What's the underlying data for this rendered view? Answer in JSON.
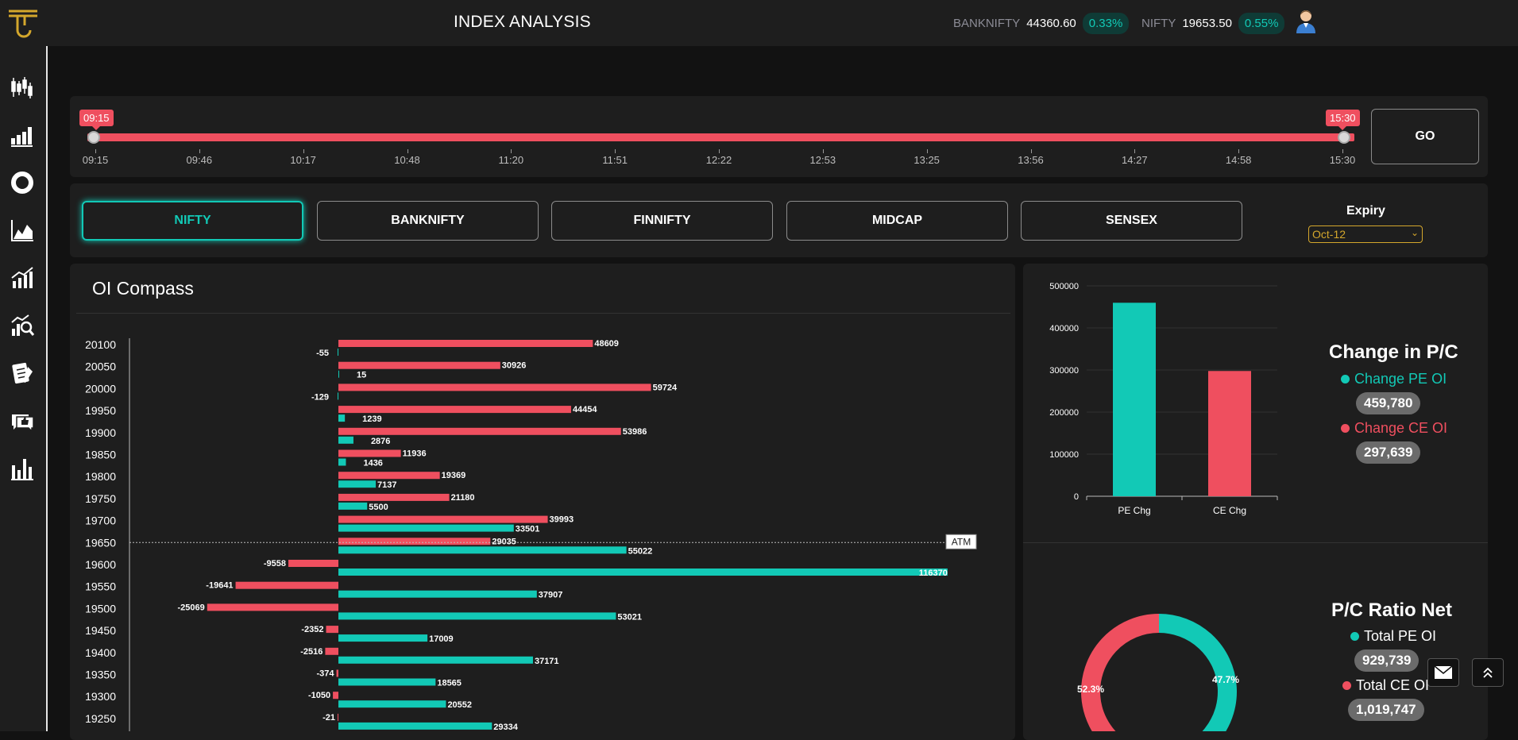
{
  "header": {
    "title": "INDEX ANALYSIS",
    "tickers": [
      {
        "name": "BANKNIFTY",
        "value": "44360.60",
        "change": "0.33%"
      },
      {
        "name": "NIFTY",
        "value": "19653.50",
        "change": "0.55%"
      }
    ]
  },
  "sidebar": {
    "icons": [
      "candlestick-icon",
      "volume-bars-icon",
      "donut-icon",
      "area-chart-icon",
      "growth-chart-icon",
      "analysis-search-icon",
      "notes-icon",
      "chat-like-icon",
      "bar-chart-icon"
    ]
  },
  "time_slider": {
    "start": "09:15",
    "end": "15:30",
    "ticks": [
      "09:15",
      "09:46",
      "10:17",
      "10:48",
      "11:20",
      "11:51",
      "12:22",
      "12:53",
      "13:25",
      "13:56",
      "14:27",
      "14:58",
      "15:30"
    ],
    "range_fraction": [
      0,
      1
    ],
    "go_label": "GO"
  },
  "index_tabs": {
    "items": [
      "NIFTY",
      "BANKNIFTY",
      "FINNIFTY",
      "MIDCAP",
      "SENSEX"
    ],
    "active": "NIFTY"
  },
  "expiry": {
    "label": "Expiry",
    "selected": "Oct-12"
  },
  "oi_compass": {
    "title": "OI Compass",
    "atm_label": "ATM",
    "atm_strike": "19650"
  },
  "change_pc": {
    "title": "Change in P/C",
    "pe_label": "Change PE OI",
    "pe_value": "459,780",
    "ce_label": "Change CE OI",
    "ce_value": "297,639"
  },
  "pc_ratio": {
    "title": "P/C Ratio Net",
    "pe_label": "Total PE OI",
    "pe_value": "929,739",
    "ce_label": "Total CE OI",
    "ce_value": "1,019,747",
    "pe_pct_label": "47.7%",
    "ce_pct_label": "52.3%"
  },
  "colors": {
    "accent": "#12c9b6",
    "call": "#ef4f5f",
    "brand": "#d4a72c",
    "panel": "#1e1e1e",
    "background": "#121212"
  },
  "chart_data": [
    {
      "type": "bar",
      "title": "OI Compass",
      "orientation": "horizontal",
      "categories": [
        "20100",
        "20050",
        "20000",
        "19950",
        "19900",
        "19850",
        "19800",
        "19750",
        "19700",
        "19650",
        "19600",
        "19550",
        "19500",
        "19450",
        "19400",
        "19350",
        "19300",
        "19250"
      ],
      "series": [
        {
          "values": [
            48609,
            30926,
            59724,
            44454,
            53986,
            11936,
            19369,
            21180,
            39993,
            29035,
            -9558,
            -19641,
            -25069,
            -2352,
            -2516,
            -374,
            -1050,
            -21
          ],
          "color": "#ef4f5f"
        },
        {
          "values": [
            -55,
            15,
            -129,
            1239,
            2876,
            1436,
            7137,
            5500,
            33501,
            55022,
            116370,
            37907,
            53021,
            17009,
            37171,
            18565,
            20552,
            29334
          ],
          "color": "#12c9b6"
        }
      ],
      "annotations": [
        "ATM"
      ]
    },
    {
      "type": "bar",
      "categories": [
        "PE Chg",
        "CE Chg"
      ],
      "values": [
        459780,
        297639
      ],
      "colors": [
        "#12c9b6",
        "#ef4f5f"
      ],
      "yticks": [
        0,
        100000,
        200000,
        300000,
        400000,
        500000
      ],
      "ylim": [
        0,
        500000
      ],
      "grid": true
    },
    {
      "type": "pie",
      "donut": true,
      "labels": [
        "Total PE OI",
        "Total CE OI"
      ],
      "values": [
        47.7,
        52.3
      ],
      "colors": [
        "#12c9b6",
        "#ef4f5f"
      ]
    }
  ]
}
